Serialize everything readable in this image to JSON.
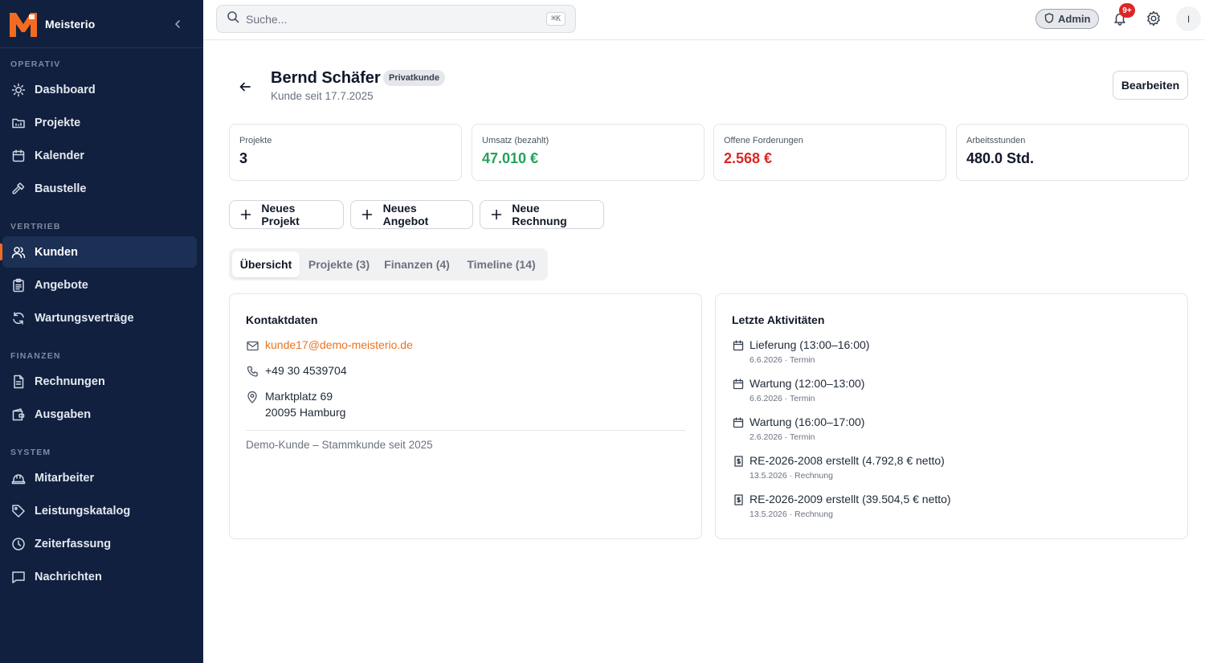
{
  "app": {
    "name": "Meisterio"
  },
  "sidebar": {
    "sections": [
      {
        "title": "OPERATIV",
        "items": [
          "Dashboard",
          "Projekte",
          "Kalender",
          "Baustelle"
        ]
      },
      {
        "title": "VERTRIEB",
        "items": [
          "Kunden",
          "Angebote",
          "Wartungsverträge"
        ]
      },
      {
        "title": "FINANZEN",
        "items": [
          "Rechnungen",
          "Ausgaben"
        ]
      },
      {
        "title": "SYSTEM",
        "items": [
          "Mitarbeiter",
          "Leistungskatalog",
          "Zeiterfassung",
          "Nachrichten"
        ]
      }
    ],
    "active_item": "Kunden"
  },
  "topbar": {
    "search_placeholder": "Suche...",
    "shortcut": "⌘K",
    "role": "Admin",
    "notification_count": "9+",
    "avatar_initial": "I"
  },
  "customer": {
    "name": "Bernd Schäfer",
    "type_badge": "Privatkunde",
    "since": "Kunde seit 17.7.2025",
    "edit_label": "Bearbeiten"
  },
  "stats": [
    {
      "label": "Projekte",
      "value": "3"
    },
    {
      "label": "Umsatz (bezahlt)",
      "value": "47.010 €"
    },
    {
      "label": "Offene Forderungen",
      "value": "2.568 €"
    },
    {
      "label": "Arbeitsstunden",
      "value": "480.0 Std."
    }
  ],
  "actions": [
    "Neues Projekt",
    "Neues Angebot",
    "Neue Rechnung"
  ],
  "tabs": [
    "Übersicht",
    "Projekte (3)",
    "Finanzen (4)",
    "Timeline (14)"
  ],
  "contact": {
    "title": "Kontaktdaten",
    "email": "kunde17@demo-meisterio.de",
    "phone": "+49 30 4539704",
    "street": "Marktplatz 69",
    "city": "20095 Hamburg",
    "note": "Demo-Kunde – Stammkunde seit 2025"
  },
  "activities": {
    "title": "Letzte Aktivitäten",
    "items": [
      {
        "icon": "calendar-icon",
        "text": "Lieferung (13:00–16:00)",
        "meta": "6.6.2026 · Termin"
      },
      {
        "icon": "calendar-icon",
        "text": "Wartung (12:00–13:00)",
        "meta": "6.6.2026 · Termin"
      },
      {
        "icon": "calendar-icon",
        "text": "Wartung (16:00–17:00)",
        "meta": "2.6.2026 · Termin"
      },
      {
        "icon": "invoice-icon",
        "text": "RE-2026-2008 erstellt (4.792,8 € netto)",
        "meta": "13.5.2026 · Rechnung"
      },
      {
        "icon": "invoice-icon",
        "text": "RE-2026-2009 erstellt (39.504,5 € netto)",
        "meta": "13.5.2026 · Rechnung"
      }
    ]
  },
  "colors": {
    "sidebar": "#11203f",
    "accent": "#f26b21",
    "positive": "#22a35a",
    "negative": "#dc2626"
  }
}
